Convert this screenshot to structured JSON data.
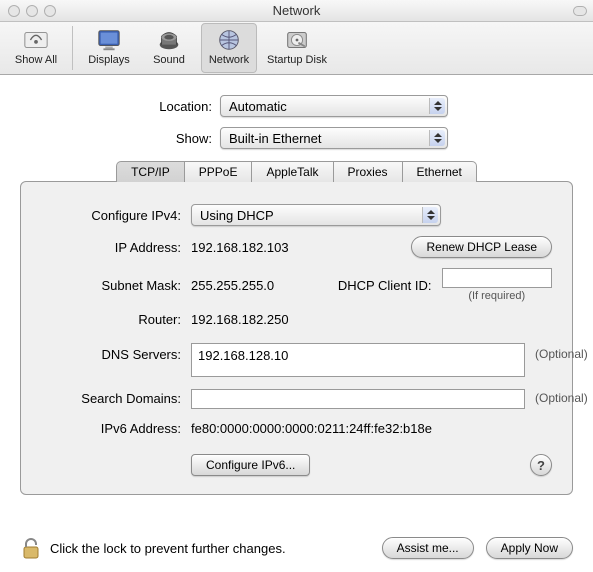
{
  "window": {
    "title": "Network"
  },
  "toolbar": {
    "show_all": "Show All",
    "displays": "Displays",
    "sound": "Sound",
    "network": "Network",
    "startup_disk": "Startup Disk"
  },
  "selectors": {
    "location_label": "Location:",
    "location_value": "Automatic",
    "show_label": "Show:",
    "show_value": "Built-in Ethernet"
  },
  "tabs": {
    "tcpip": "TCP/IP",
    "pppoe": "PPPoE",
    "appletalk": "AppleTalk",
    "proxies": "Proxies",
    "ethernet": "Ethernet"
  },
  "tcpip": {
    "configure_label": "Configure IPv4:",
    "configure_value": "Using DHCP",
    "ip_label": "IP Address:",
    "ip_value": "192.168.182.103",
    "renew_button": "Renew DHCP Lease",
    "subnet_label": "Subnet Mask:",
    "subnet_value": "255.255.255.0",
    "dhcp_client_label": "DHCP Client ID:",
    "dhcp_client_value": "",
    "dhcp_required_note": "(If required)",
    "router_label": "Router:",
    "router_value": "192.168.182.250",
    "dns_label": "DNS Servers:",
    "dns_value": "192.168.128.10",
    "search_label": "Search Domains:",
    "search_value": "",
    "optional_text": "(Optional)",
    "ipv6_label": "IPv6 Address:",
    "ipv6_value": "fe80:0000:0000:0000:0211:24ff:fe32:b18e",
    "configure_ipv6_button": "Configure IPv6...",
    "help_label": "?"
  },
  "footer": {
    "lock_text": "Click the lock to prevent further changes.",
    "assist_button": "Assist me...",
    "apply_button": "Apply Now"
  }
}
